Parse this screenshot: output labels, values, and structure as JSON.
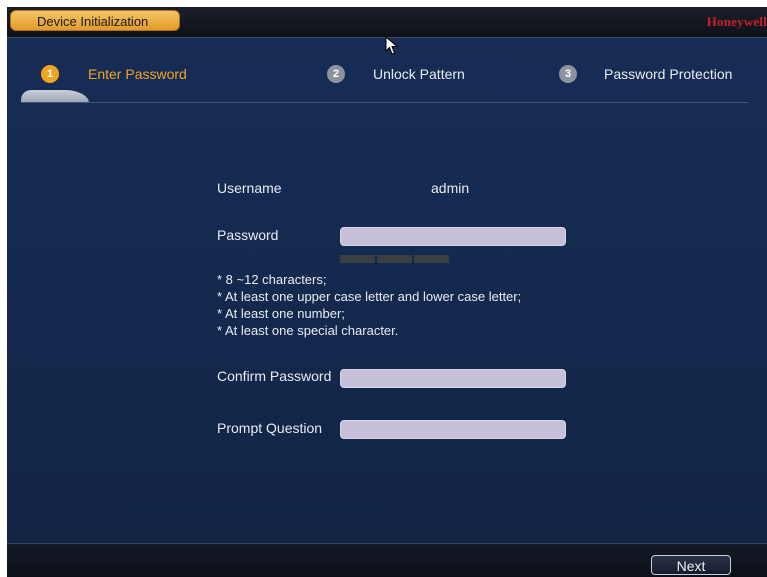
{
  "window": {
    "title": "Device Initialization",
    "brand": "Honeywell"
  },
  "steps": [
    {
      "number": "1",
      "label": "Enter Password",
      "active": true
    },
    {
      "number": "2",
      "label": "Unlock Pattern",
      "active": false
    },
    {
      "number": "3",
      "label": "Password Protection",
      "active": false
    }
  ],
  "form": {
    "username_label": "Username",
    "username_value": "admin",
    "password_label": "Password",
    "password_value": "",
    "confirm_label": "Confirm Password",
    "confirm_value": "",
    "prompt_label": "Prompt Question",
    "prompt_value": ""
  },
  "rules": [
    "* 8 ~12  characters;",
    "* At least one upper case letter and lower case letter;",
    "* At least one number;",
    "* At least one special character."
  ],
  "footer": {
    "next_label": "Next"
  },
  "colors": {
    "accent": "#f0a520",
    "background": "#15284a",
    "brand": "#c8202a"
  }
}
